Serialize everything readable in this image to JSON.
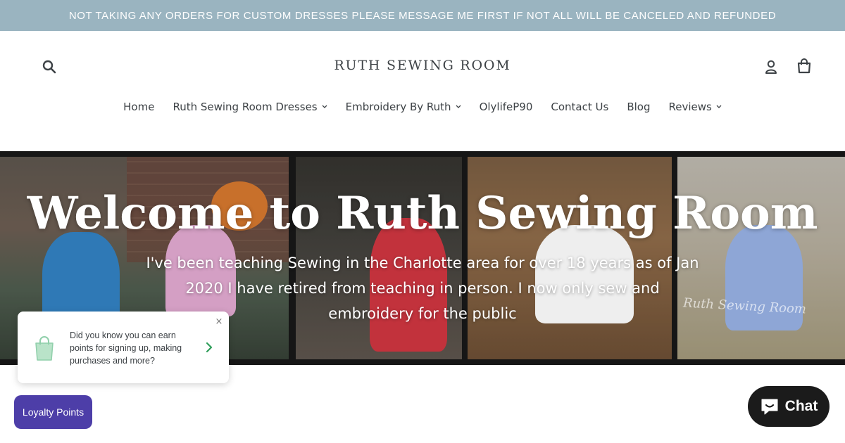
{
  "announcement": {
    "text": "NOT TAKING ANY ORDERS FOR CUSTOM DRESSES PLEASE MESSAGE ME FIRST IF NOT ALL WILL BE CANCELED AND REFUNDED"
  },
  "header": {
    "site_title": "RUTH SEWING ROOM",
    "icons": {
      "search": "search-icon",
      "account": "user-icon",
      "cart": "cart-icon"
    },
    "login_label": "Log in",
    "cart_label": "Cart"
  },
  "nav": {
    "items": [
      {
        "label": "Home",
        "dropdown": false
      },
      {
        "label": "Ruth Sewing Room Dresses",
        "dropdown": true
      },
      {
        "label": "Embroidery By Ruth",
        "dropdown": true
      },
      {
        "label": "OlylifeP90",
        "dropdown": false
      },
      {
        "label": "Contact Us",
        "dropdown": false
      },
      {
        "label": "Blog",
        "dropdown": false
      },
      {
        "label": "Reviews",
        "dropdown": true
      }
    ]
  },
  "hero": {
    "title": "Welcome to Ruth Sewing Room",
    "subtitle": "I've been teaching Sewing in the Charlotte area for over 18 years as of Jan 2020 I have retired from teaching in person. I now only sew and embroidery for the public",
    "watermark": "Ruth Sewing Room"
  },
  "loyalty_popup": {
    "text": "Did you know you can earn points for signing up, making purchases and more?",
    "close_label": "×"
  },
  "loyalty_button": {
    "label": "Loyalty Points"
  },
  "chat_button": {
    "label": "Chat"
  },
  "colors": {
    "announcement_bg": "#9ab4c0",
    "text": "#3d4246",
    "loyalty_purple": "#4d3ea8",
    "chat_bg": "#1b1b1b"
  }
}
